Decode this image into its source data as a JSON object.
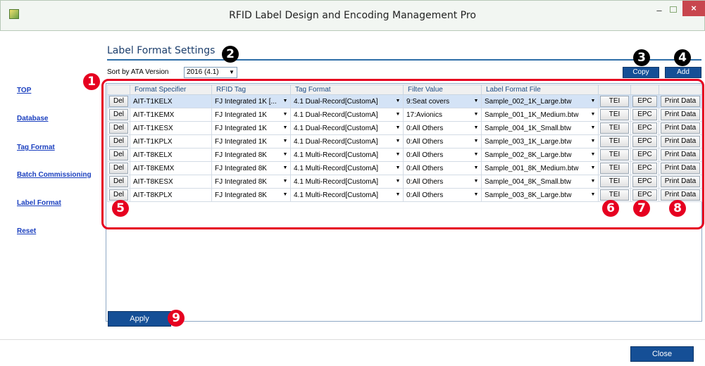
{
  "window": {
    "title": "RFID Label Design and Encoding Management Pro",
    "minimize": "–",
    "close": "×"
  },
  "nav": {
    "items": [
      "TOP",
      "Database",
      "Tag Format",
      "Batch Commissioning",
      "Label Format",
      "Reset"
    ]
  },
  "page": {
    "title": "Label Format Settings",
    "sort_label": "Sort by  ATA Version",
    "sort_value": "2016 (4.1)",
    "copy_label": "Copy",
    "add_label": "Add",
    "apply_label": "Apply",
    "close_label": "Close"
  },
  "table": {
    "headers": [
      "",
      "Format Specifier",
      "RFID Tag",
      "Tag Format",
      "Filter Value",
      "Label Format File",
      "",
      "",
      ""
    ],
    "rows": [
      {
        "del": "Del",
        "format": "AIT-T1KELX",
        "rfid": "FJ Integrated 1K [...",
        "tag_format": "4.1 Dual-Record[CustomA]",
        "filter": "9:Seat covers",
        "file": "Sample_002_1K_Large.btw",
        "tei": "TEI",
        "epc": "EPC",
        "print": "Print Data"
      },
      {
        "del": "Del",
        "format": "AIT-T1KEMX",
        "rfid": "FJ Integrated 1K",
        "tag_format": "4.1 Dual-Record[CustomA]",
        "filter": "17:Avionics",
        "file": "Sample_001_1K_Medium.btw",
        "tei": "TEI",
        "epc": "EPC",
        "print": "Print Data"
      },
      {
        "del": "Del",
        "format": "AIT-T1KESX",
        "rfid": "FJ Integrated 1K",
        "tag_format": "4.1 Dual-Record[CustomA]",
        "filter": "0:All Others",
        "file": "Sample_004_1K_Small.btw",
        "tei": "TEI",
        "epc": "EPC",
        "print": "Print Data"
      },
      {
        "del": "Del",
        "format": "AIT-T1KPLX",
        "rfid": "FJ Integrated 1K",
        "tag_format": "4.1 Dual-Record[CustomA]",
        "filter": "0:All Others",
        "file": "Sample_003_1K_Large.btw",
        "tei": "TEI",
        "epc": "EPC",
        "print": "Print Data"
      },
      {
        "del": "Del",
        "format": "AIT-T8KELX",
        "rfid": "FJ Integrated 8K",
        "tag_format": "4.1 Multi-Record[CustomA]",
        "filter": "0:All Others",
        "file": "Sample_002_8K_Large.btw",
        "tei": "TEI",
        "epc": "EPC",
        "print": "Print Data"
      },
      {
        "del": "Del",
        "format": "AIT-T8KEMX",
        "rfid": "FJ Integrated 8K",
        "tag_format": "4.1 Multi-Record[CustomA]",
        "filter": "0:All Others",
        "file": "Sample_001_8K_Medium.btw",
        "tei": "TEI",
        "epc": "EPC",
        "print": "Print Data"
      },
      {
        "del": "Del",
        "format": "AIT-T8KESX",
        "rfid": "FJ Integrated 8K",
        "tag_format": "4.1 Multi-Record[CustomA]",
        "filter": "0:All Others",
        "file": "Sample_004_8K_Small.btw",
        "tei": "TEI",
        "epc": "EPC",
        "print": "Print Data"
      },
      {
        "del": "Del",
        "format": "AIT-T8KPLX",
        "rfid": "FJ Integrated 8K",
        "tag_format": "4.1 Multi-Record[CustomA]",
        "filter": "0:All Others",
        "file": "Sample_003_8K_Large.btw",
        "tei": "TEI",
        "epc": "EPC",
        "print": "Print Data"
      }
    ]
  },
  "markers": [
    "1",
    "2",
    "3",
    "4",
    "5",
    "6",
    "7",
    "8",
    "9"
  ],
  "colors": {
    "accent_red": "#e60020",
    "button_blue": "#154f96",
    "nav_link": "#1a3fbf"
  }
}
